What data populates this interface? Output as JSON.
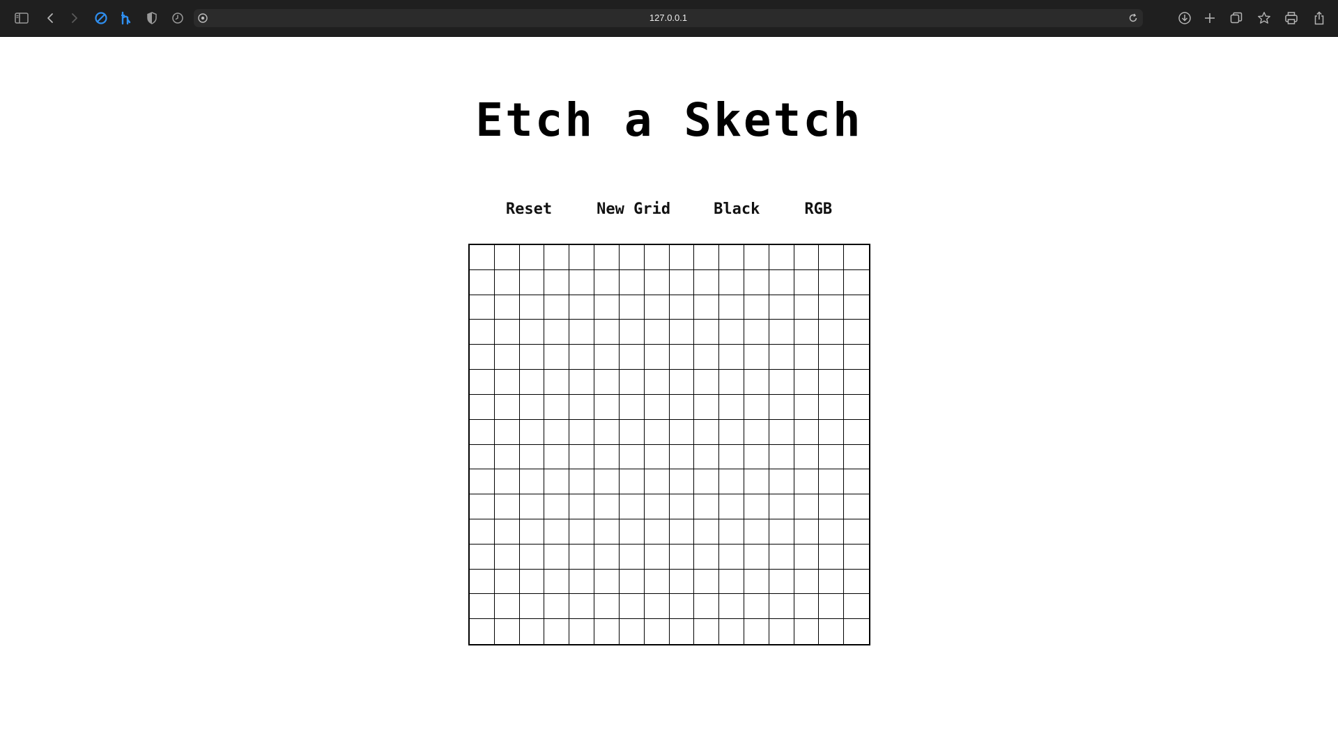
{
  "browser": {
    "url": "127.0.0.1",
    "accent_color": "#2f8ff0"
  },
  "page": {
    "title": "Etch a Sketch",
    "buttons": [
      {
        "label": "Reset"
      },
      {
        "label": "New Grid"
      },
      {
        "label": "Black"
      },
      {
        "label": "RGB"
      }
    ],
    "grid": {
      "size": 16,
      "line_color": "#000000",
      "cell_color": "#ffffff"
    }
  }
}
